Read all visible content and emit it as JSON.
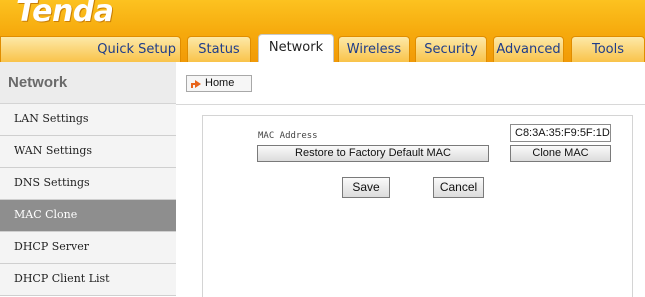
{
  "brand": {
    "logo_text": "Tenda"
  },
  "nav": {
    "tabs": [
      {
        "label": "Quick Setup"
      },
      {
        "label": "Status"
      },
      {
        "label": "Network"
      },
      {
        "label": "Wireless"
      },
      {
        "label": "Security"
      },
      {
        "label": "Advanced"
      },
      {
        "label": "Tools"
      }
    ],
    "active_tab": "Network"
  },
  "sidebar": {
    "title": "Network",
    "items": [
      {
        "label": "LAN Settings"
      },
      {
        "label": "WAN Settings"
      },
      {
        "label": "DNS Settings"
      },
      {
        "label": "MAC Clone"
      },
      {
        "label": "DHCP Server"
      },
      {
        "label": "DHCP Client List"
      }
    ],
    "active_item": "MAC Clone"
  },
  "breadcrumb": {
    "home_label": "Home"
  },
  "form": {
    "mac_label": "MAC Address",
    "mac_value": "C8:3A:35:F9:5F:1D",
    "restore_label": "Restore to Factory Default MAC",
    "clone_label": "Clone MAC",
    "save_label": "Save",
    "cancel_label": "Cancel"
  },
  "colors": {
    "header_orange": "#f6a90c",
    "tab_text_blue": "#1f3d8a",
    "sidebar_active": "#8e8e8e",
    "home_arrow": "#e8641b"
  }
}
